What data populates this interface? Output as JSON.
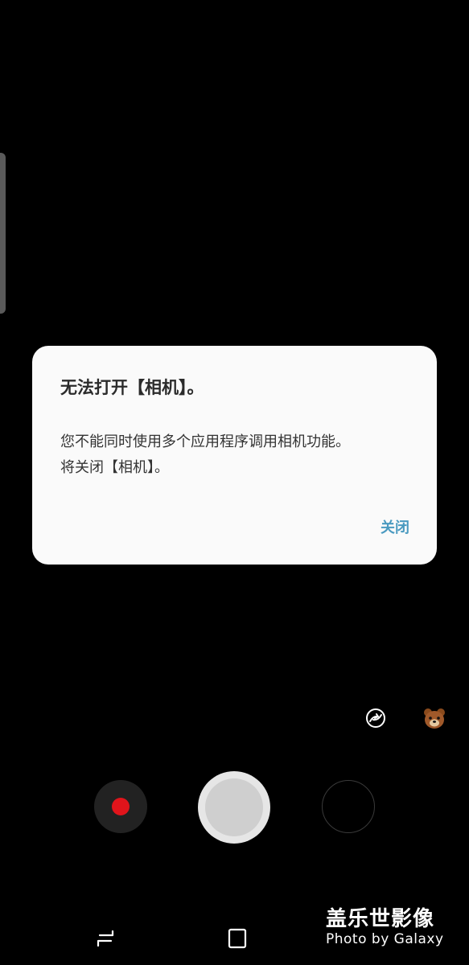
{
  "dialog": {
    "title": "无法打开【相机】。",
    "message_line1": "您不能同时使用多个应用程序调用相机功能。",
    "message_line2": "将关闭【相机】。",
    "close_label": "关闭"
  },
  "camera": {
    "icons": [
      "rotate-camera-icon",
      "bear-sticker-icon"
    ],
    "record_color": "#e0141b"
  },
  "nav": {
    "icons": [
      "recent-apps-icon",
      "home-icon"
    ]
  },
  "watermark": {
    "main": "盖乐世影像",
    "sub": "Photo by Galaxy"
  },
  "colors": {
    "background": "#000000",
    "dialog_bg": "#fafafa",
    "accent": "#4a9ac0"
  }
}
